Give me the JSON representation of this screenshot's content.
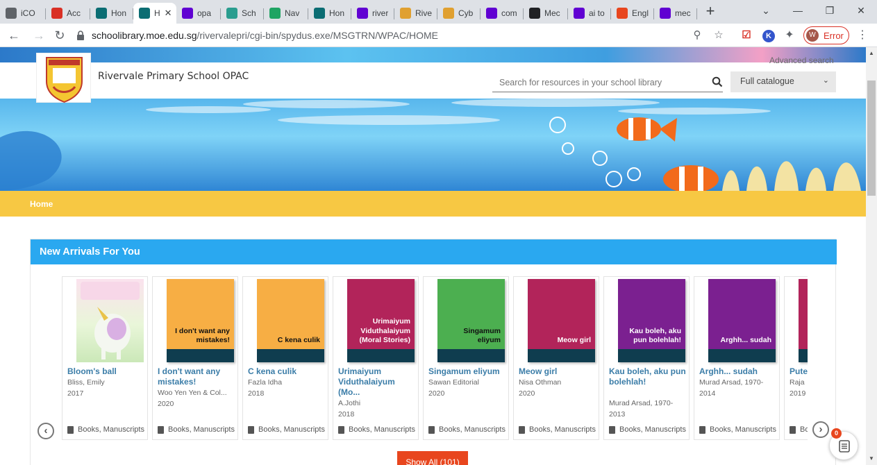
{
  "browser": {
    "tabs": [
      {
        "title": "iCO",
        "icon": "globe-icon",
        "color": "#5f6368"
      },
      {
        "title": "Acc",
        "icon": "gmail-icon",
        "color": "#d93025"
      },
      {
        "title": "Hon",
        "icon": "e10-icon",
        "color": "#0b6d73"
      },
      {
        "title": "H",
        "icon": "e10-icon",
        "color": "#0b6d73",
        "active": true
      },
      {
        "title": "opa",
        "icon": "yahoo-icon",
        "color": "#6001d2"
      },
      {
        "title": "Sch",
        "icon": "shield-icon",
        "color": "#2a9d8f"
      },
      {
        "title": "Nav",
        "icon": "drive-icon",
        "color": "#1fa463"
      },
      {
        "title": "Hon",
        "icon": "e10-icon",
        "color": "#0b6d73"
      },
      {
        "title": "river",
        "icon": "yahoo-icon",
        "color": "#6001d2"
      },
      {
        "title": "Rive",
        "icon": "school-crest-icon",
        "color": "#e0a030"
      },
      {
        "title": "Cyb",
        "icon": "school-crest-icon",
        "color": "#e0a030"
      },
      {
        "title": "com",
        "icon": "yahoo-icon",
        "color": "#6001d2"
      },
      {
        "title": "Mec",
        "icon": "target-icon",
        "color": "#202124"
      },
      {
        "title": "ai to",
        "icon": "yahoo-icon",
        "color": "#6001d2"
      },
      {
        "title": "Engl",
        "icon": "translate-icon",
        "color": "#e8461e"
      },
      {
        "title": "mec",
        "icon": "yahoo-icon",
        "color": "#6001d2"
      }
    ],
    "url_host": "schoolibrary.moe.edu.sg",
    "url_path": "/rivervalepri/cgi-bin/spydus.exe/MSGTRN/WPAC/HOME",
    "profile_initial": "W",
    "profile_status": "Error"
  },
  "header": {
    "site_title": "Rivervale Primary School OPAC",
    "advanced_search": "Advanced search",
    "search_placeholder": "Search for resources in your school library",
    "catalogue_selected": "Full catalogue"
  },
  "nav": {
    "home": "Home"
  },
  "arrivals": {
    "heading": "New Arrivals For You",
    "show_all": "Show All (101)",
    "fab_badge": "0",
    "books": [
      {
        "cover_text": "",
        "cover_color": "#f4c6dc",
        "image_cover": true,
        "title": "Bloom's ball",
        "author": "Bliss, Emily",
        "year": "2017",
        "type": "Books, Manuscripts"
      },
      {
        "cover_text": "I don't want any mistakes!",
        "cover_color": "#f7ae44",
        "dark": true,
        "title": "I don't want any mistakes!",
        "author": "Woo Yen Yen & Col...",
        "year": "2020",
        "type": "Books, Manuscripts"
      },
      {
        "cover_text": "C kena culik",
        "cover_color": "#f7ae44",
        "dark": true,
        "title": "C kena culik",
        "author": "Fazla Idha",
        "year": "2018",
        "type": "Books, Manuscripts"
      },
      {
        "cover_text": "Urimaiyum Viduthalaiyum (Moral Stories)",
        "cover_color": "#b2245a",
        "title": "Urimaiyum Viduthalaiyum (Mo...",
        "author": "A.Jothi",
        "year": "2018",
        "type": "Books, Manuscripts"
      },
      {
        "cover_text": "Singamum eliyum",
        "cover_color": "#4caf50",
        "dark": true,
        "title": "Singamum eliyum",
        "author": "Sawan Editorial",
        "year": "2020",
        "type": "Books, Manuscripts"
      },
      {
        "cover_text": "Meow girl",
        "cover_color": "#b2245a",
        "title": "Meow girl",
        "author": "Nisa Othman",
        "year": "2020",
        "type": "Books, Manuscripts"
      },
      {
        "cover_text": "Kau boleh, aku pun bolehlah!",
        "cover_color": "#7b2090",
        "title": "Kau boleh, aku pun bolehlah!",
        "author": "Murad Arsad, 1970-",
        "year": "2013",
        "type": "Books, Manuscripts"
      },
      {
        "cover_text": "Arghh... sudah",
        "cover_color": "#7b2090",
        "title": "Arghh... sudah",
        "author": "Murad Arsad, 1970-",
        "year": "2014",
        "type": "Books, Manuscripts"
      },
      {
        "cover_text": "",
        "cover_color": "#b2245a",
        "title": "Pute Leda",
        "author": "Raja",
        "year": "2019",
        "type": "Books, Manuscripts"
      }
    ]
  }
}
